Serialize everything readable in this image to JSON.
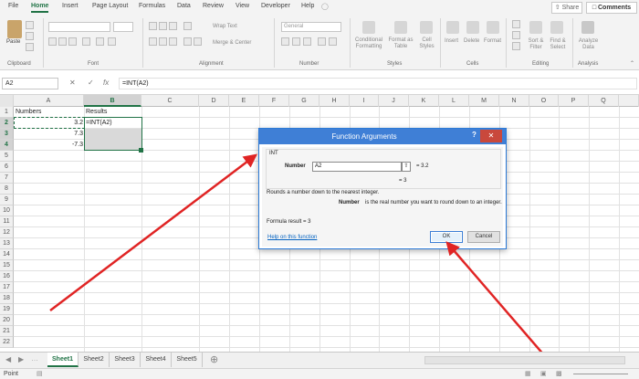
{
  "ribbon_tabs": [
    "File",
    "Home",
    "Insert",
    "Page Layout",
    "Formulas",
    "Data",
    "Review",
    "View",
    "Developer",
    "Help"
  ],
  "active_tab": "Home",
  "share_label": "Share",
  "comments_label": "Comments",
  "ribbon": {
    "paste_label": "Paste",
    "wrap_text": "Wrap Text",
    "merge_center": "Merge & Center",
    "number_format": "General",
    "conditional_formatting": "Conditional Formatting",
    "format_as_table": "Format as Table",
    "cell_styles": "Cell Styles",
    "insert": "Insert",
    "delete": "Delete",
    "format": "Format",
    "sort_filter": "Sort & Filter",
    "find_select": "Find & Select",
    "analyze_data": "Analyze Data",
    "groups": {
      "clipboard": "Clipboard",
      "font": "Font",
      "alignment": "Alignment",
      "number": "Number",
      "styles": "Styles",
      "cells": "Cells",
      "editing": "Editing",
      "analysis": "Analysis"
    }
  },
  "formula_bar": {
    "name_box": "A2",
    "cancel_icon": "✕",
    "enter_icon": "✓",
    "fx_icon": "fx",
    "formula": "=INT(A2)"
  },
  "columns": [
    "A",
    "B",
    "C",
    "D",
    "E",
    "F",
    "G",
    "H",
    "I",
    "J",
    "K",
    "L",
    "M",
    "N",
    "O",
    "P",
    "Q"
  ],
  "rows": [
    "1",
    "2",
    "3",
    "4",
    "5",
    "6",
    "7",
    "8",
    "9",
    "10",
    "11",
    "12",
    "13",
    "14",
    "15",
    "16",
    "17",
    "18",
    "19",
    "20",
    "21",
    "22"
  ],
  "cells": {
    "a1": "Numbers",
    "b1": "Results",
    "a2": "3.2",
    "b2": "=INT(A2)",
    "a3": "7.3",
    "a4": "-7.3"
  },
  "dialog": {
    "title": "Function Arguments",
    "help": "?",
    "close": "✕",
    "function_name": "INT",
    "arg_label": "Number",
    "arg_value": "A2",
    "arg_result": "=  3.2",
    "result_line": "=  3",
    "description": "Rounds a number down to the nearest integer.",
    "arg_name_bold": "Number",
    "arg_description": "is the real number you want to round down to an integer.",
    "formula_result": "Formula result =   3",
    "help_link": "Help on this function",
    "ok": "OK",
    "cancel": "Cancel"
  },
  "sheets": [
    "Sheet1",
    "Sheet2",
    "Sheet3",
    "Sheet4",
    "Sheet5"
  ],
  "active_sheet": "Sheet1",
  "status": "Point",
  "colors": {
    "accent": "#217346",
    "dialog_title": "#3f7fd6",
    "annotation_arrow": "#e02424"
  }
}
